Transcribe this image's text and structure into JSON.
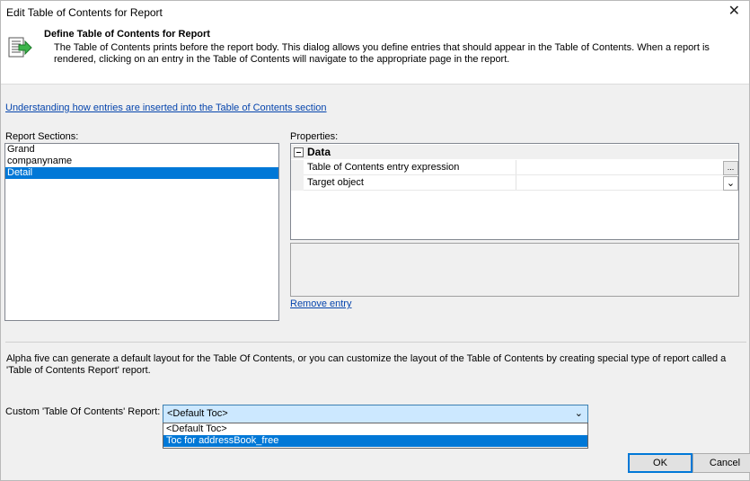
{
  "window": {
    "title": "Edit Table of Contents for Report",
    "close_glyph": "✕"
  },
  "header": {
    "icon": "toc-arrow-icon",
    "title": "Define Table of Contents for Report",
    "description": "The Table of Contents prints before the report body.  This dialog allows you define entries that should appear in the Table of Contents. When a report is rendered, clicking on an entry in the Table of Contents will navigate to the appropriate page in the report."
  },
  "help_link": "Understanding how entries are inserted into the Table of Contents section",
  "sections": {
    "label": "Report Sections:",
    "items": [
      "Grand",
      "companyname",
      "Detail"
    ],
    "selected": "Detail"
  },
  "properties": {
    "label": "Properties:",
    "category": "Data",
    "rows": [
      {
        "name": "Table of Contents entry expression",
        "value": "",
        "button": "..."
      },
      {
        "name": "Target object",
        "value": "",
        "button": "⌄"
      }
    ]
  },
  "remove_link": "Remove entry",
  "info_text": "Alpha five can generate a default layout for the Table Of Contents, or you can customize the layout of the Table of Contents by creating special type of report called a 'Table of Contents Report' report.",
  "custom_report": {
    "label": "Custom 'Table Of Contents' Report:",
    "selected": "<Default Toc>",
    "arrow": "⌄",
    "options": [
      "<Default Toc>",
      "Toc for addressBook_free"
    ],
    "highlighted": "Toc for addressBook_free"
  },
  "buttons": {
    "ok": "OK",
    "cancel": "Cancel"
  },
  "colors": {
    "selection": "#0078d7",
    "link": "#0645ad",
    "combo_bg": "#cce8ff"
  }
}
